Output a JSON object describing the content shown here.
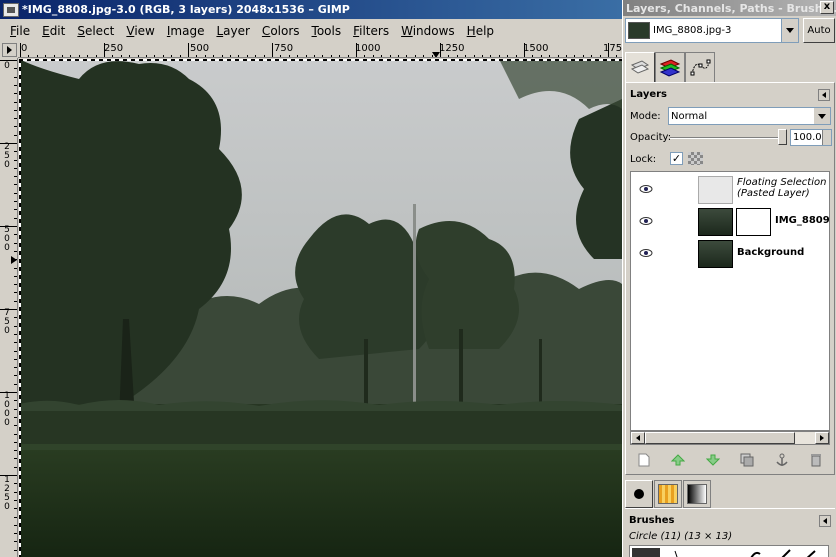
{
  "image_window": {
    "title": "*IMG_8808.jpg-3.0 (RGB, 3 layers) 2048x1536 – GIMP",
    "menu": [
      "File",
      "Edit",
      "Select",
      "View",
      "Image",
      "Layer",
      "Colors",
      "Tools",
      "Filters",
      "Windows",
      "Help"
    ],
    "h_ruler_labels": [
      "0",
      "250",
      "500",
      "750",
      "1000",
      "1250",
      "1500",
      "175"
    ],
    "v_ruler_labels": [
      "0",
      "250",
      "500",
      "750",
      "1000",
      "1250"
    ]
  },
  "dock": {
    "title": "Layers, Channels, Paths - Brushe…",
    "close_label": "x",
    "image_selector": "IMG_8808.jpg-3",
    "auto_label": "Auto",
    "layers": {
      "title": "Layers",
      "mode_label": "Mode:",
      "mode_value": "Normal",
      "opacity_label": "Opacity:",
      "opacity_value": "100.0",
      "opacity_fraction": 1.0,
      "lock_label": "Lock:",
      "lock_checked": "✓",
      "items": [
        {
          "name": "Floating Selection\n(Pasted Layer)",
          "line1": "Floating Selection",
          "line2": "(Pasted Layer)"
        },
        {
          "name": "IMG_8809"
        },
        {
          "name": "Background"
        }
      ]
    },
    "brushes": {
      "title": "Brushes",
      "current": "Circle (11) (13 × 13)"
    }
  },
  "colors": {
    "title_active": "#0a246a",
    "title_inactive": "#808080",
    "sky": "#c8cbcc",
    "foliage": "#2a3a26",
    "grass": "#1e3018"
  }
}
